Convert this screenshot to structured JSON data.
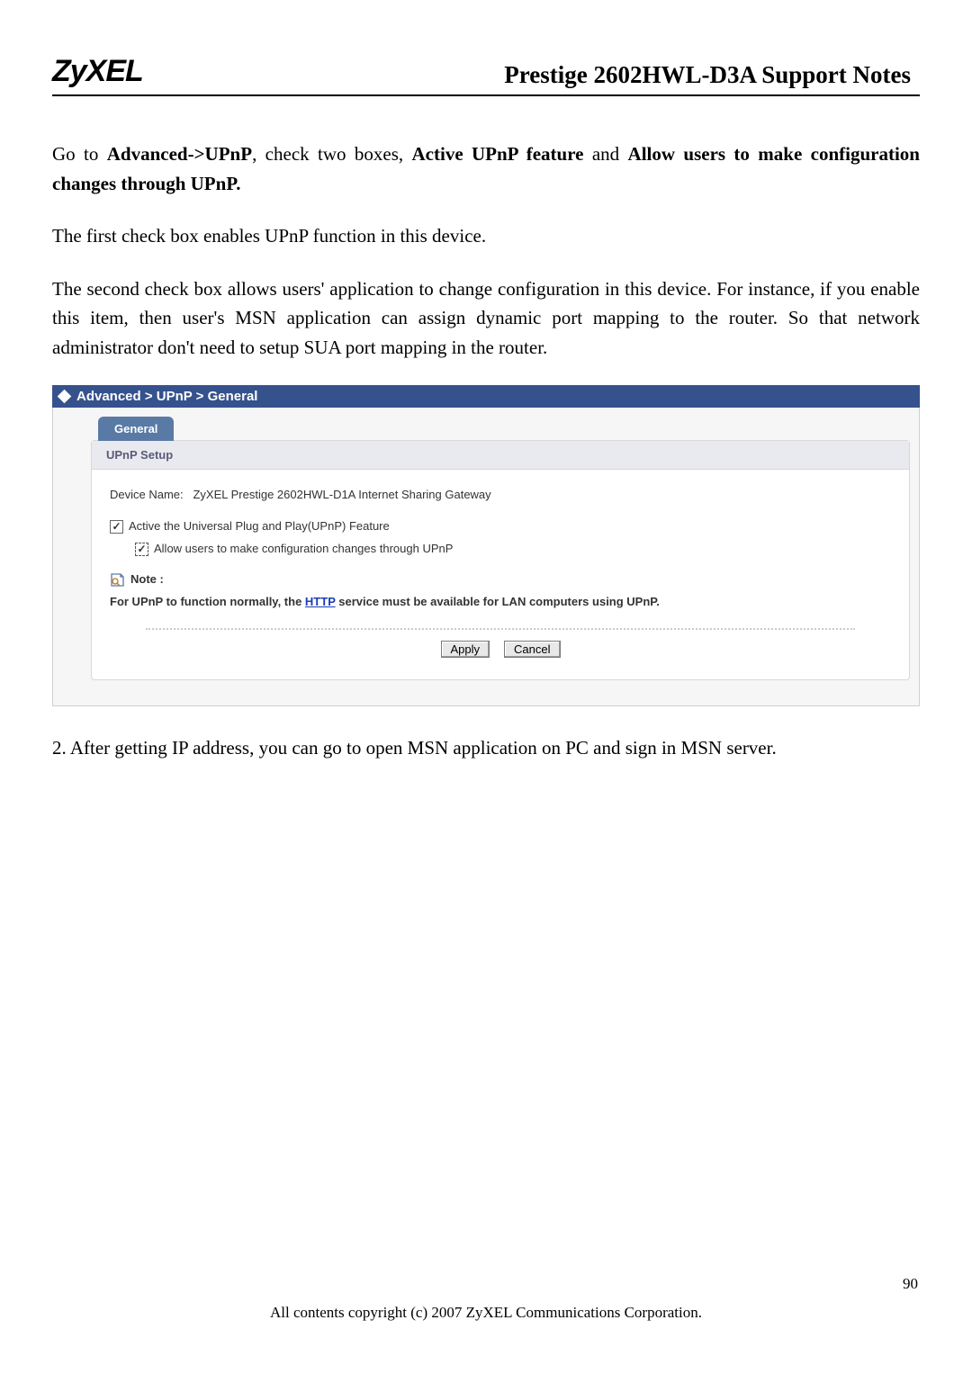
{
  "header": {
    "logo": "ZyXEL",
    "title": "Prestige 2602HWL-D3A Support Notes"
  },
  "para1": {
    "t1": "Go to ",
    "b1": "Advanced->UPnP",
    "t2": ", check two boxes, ",
    "b2": "Active UPnP feature",
    "t3": " and ",
    "b3": "Allow users to make configuration changes through UPnP."
  },
  "para2": "The first check box enables UPnP function in this device.",
  "para3": "The second check box allows users' application to change configuration in this device. For instance, if you enable this item, then user's MSN application can assign dynamic port mapping to the router. So that network administrator don't need to setup SUA port mapping in the router.",
  "ui": {
    "breadcrumb": "Advanced > UPnP > General",
    "tab": "General",
    "section_header": "UPnP Setup",
    "device_name_label": "Device Name:",
    "device_name_value": "ZyXEL Prestige 2602HWL-D1A Internet Sharing Gateway",
    "cb1_label": "Active the Universal Plug and Play(UPnP) Feature",
    "cb2_label": "Allow users to make configuration changes through UPnP",
    "check_mark": "✓",
    "note_label": "Note :",
    "note_pre": "For UPnP to function normally, the ",
    "note_link": "HTTP",
    "note_post": " service must be available for LAN computers using UPnP.",
    "apply": "Apply",
    "cancel": "Cancel"
  },
  "para4": "2. After getting IP address, you can go to open MSN application on PC and sign in MSN server.",
  "footer": "All contents copyright (c) 2007 ZyXEL Communications Corporation.",
  "page_number": "90"
}
